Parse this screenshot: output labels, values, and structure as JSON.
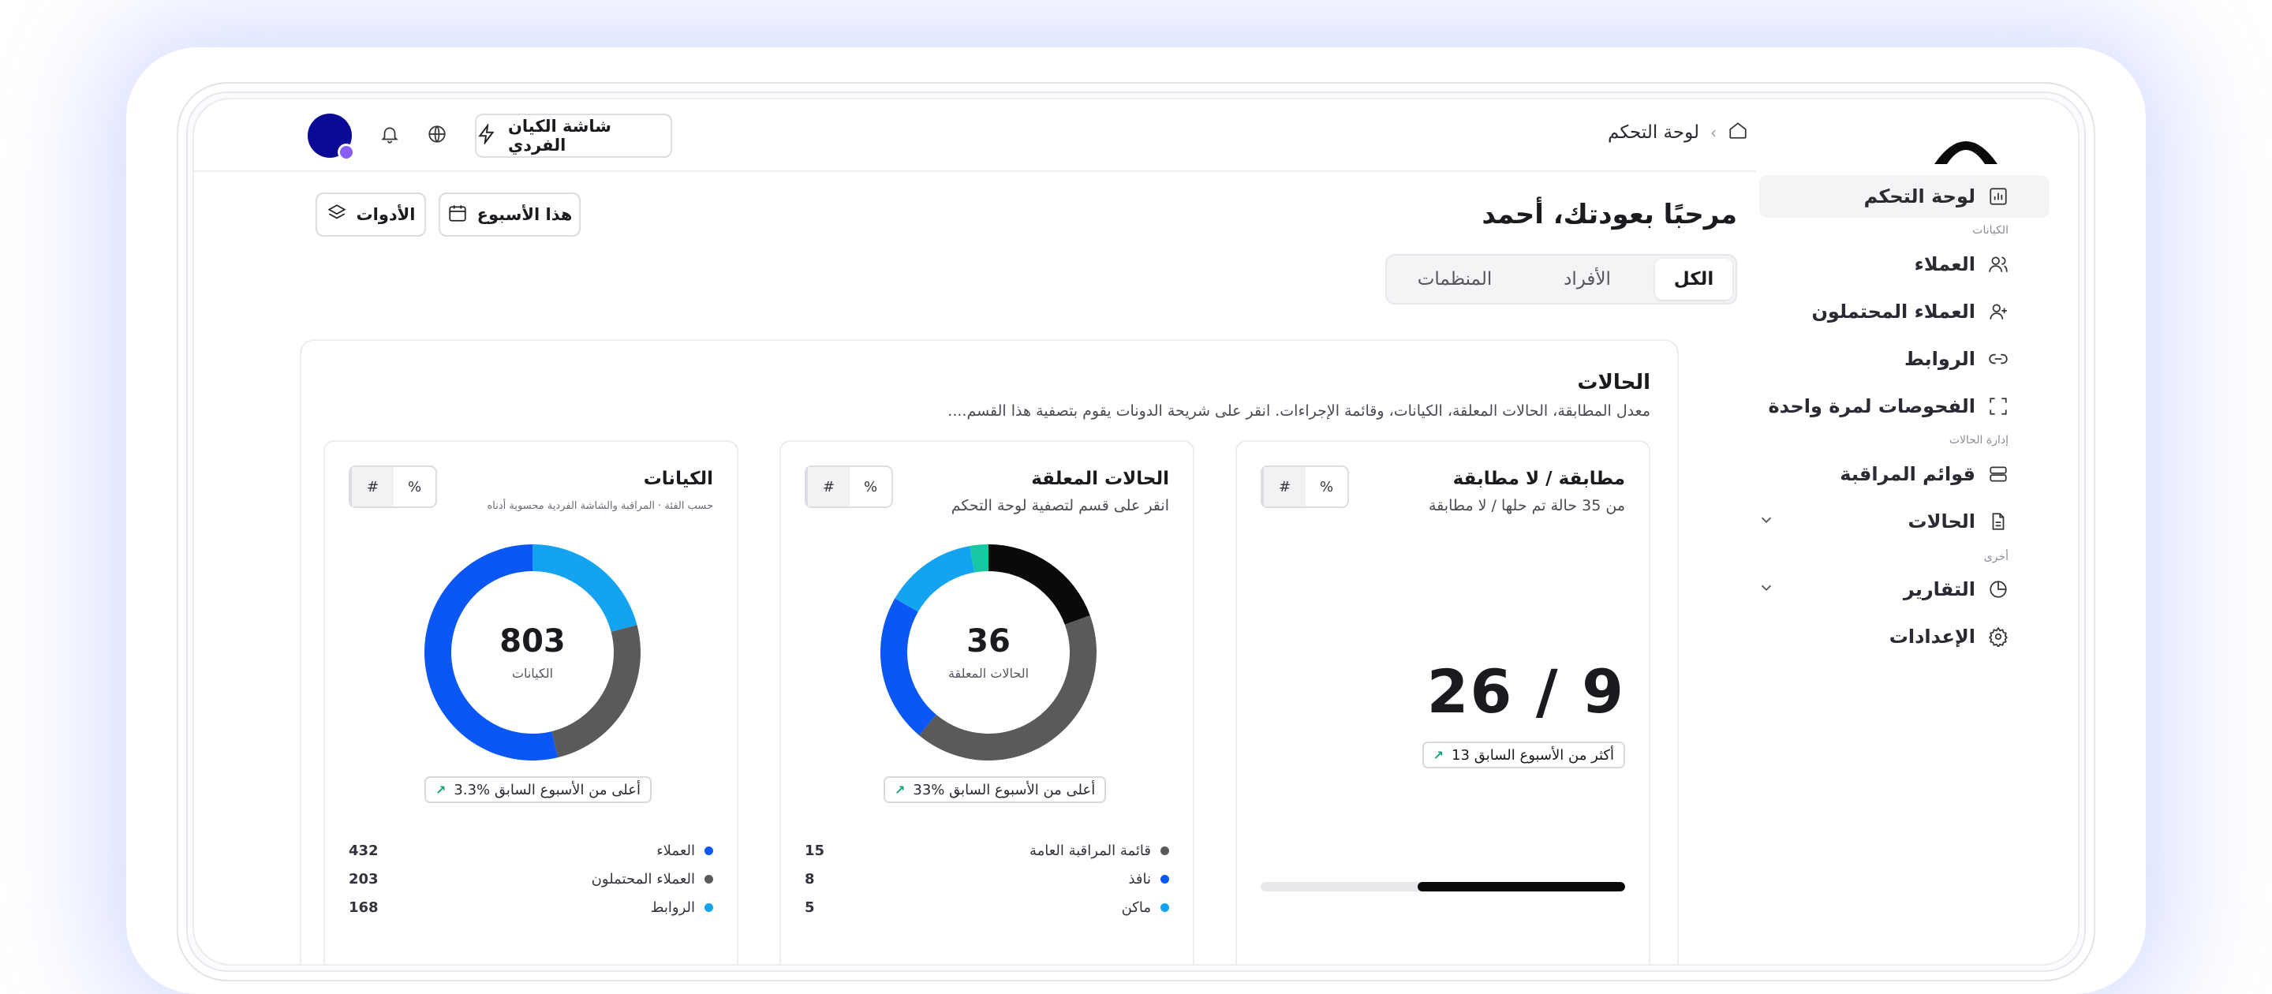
{
  "colors": {
    "primary_blue": "#0b57f5",
    "sky_blue": "#14a3f0",
    "dark_gray": "#5a5a5a",
    "black": "#0a0a0a",
    "teal": "#16c9a4",
    "avatar": "#0a0a96",
    "avatar_badge": "#8a5cf6",
    "positive": "#12a37a"
  },
  "sidebar": {
    "items": [
      {
        "label": "لوحة التحكم",
        "icon": "chart-icon"
      },
      {
        "label": "العملاء",
        "icon": "users-icon"
      },
      {
        "label": "العملاء المحتملون",
        "icon": "user-plus-icon"
      },
      {
        "label": "الروابط",
        "icon": "link-icon"
      },
      {
        "label": "الفحوصات لمرة واحدة",
        "icon": "scan-icon"
      },
      {
        "label": "قوائم المراقبة",
        "icon": "server-icon"
      },
      {
        "label": "الحالات",
        "icon": "file-icon"
      },
      {
        "label": "التقارير",
        "icon": "pie-icon"
      },
      {
        "label": "الإعدادات",
        "icon": "gear-icon"
      }
    ],
    "sections": {
      "entities": "الكيانات",
      "cases_mgmt": "إدارة الحالات",
      "other": "أخرى"
    }
  },
  "topbar": {
    "breadcrumb": "لوحة التحكم",
    "switch_label": "شاشة الكيان الفردي"
  },
  "header": {
    "title": "مرحبًا بعودتك، أحمد",
    "week_label": "هذا الأسبوع",
    "tools_label": "الأدوات"
  },
  "tabs": [
    "الكل",
    "الأفراد",
    "المنظمات"
  ],
  "panel": {
    "title": "الحالات",
    "subtitle": "معدل المطابقة، الحالات المعلقة، الكيانات، وقائمة الإجراءات. انقر على شريحة الدونات يقوم بتصفية هذا القسم...."
  },
  "toggle": {
    "percent": "%",
    "hash": "#"
  },
  "match_card": {
    "title": "مطابقة / لا مطابقة",
    "subtitle": "من 35 حالة تم حلها / لا مطابقة",
    "stat": "26 / 9",
    "delta": "13 أكثر من الأسبوع السابق",
    "progress_fraction": 0.57
  },
  "pending_card": {
    "title": "الحالات المعلقة",
    "subtitle": "انقر على قسم لتصفية لوحة التحكم",
    "total": "36",
    "total_label": "الحالات المعلقة",
    "delta": "33% أعلى من الأسبوع السابق",
    "legend": [
      {
        "label": "قائمة المراقبة العامة",
        "value": "15",
        "color": "#5a5a5a"
      },
      {
        "label": "نافذ",
        "value": "8",
        "color": "#0b57f5"
      },
      {
        "label": "ماكن",
        "value": "5",
        "color": "#14a3f0"
      }
    ],
    "chart_data": {
      "type": "pie",
      "values": [
        7,
        15,
        8,
        5,
        1
      ],
      "colors": [
        "#0a0a0a",
        "#5a5a5a",
        "#0b57f5",
        "#14a3f0",
        "#16c9a4"
      ]
    }
  },
  "entities_card": {
    "title": "الكيانات",
    "subtitle": "حسب الفئة · المراقبة والشاشة الفردية محسوبة أدناه",
    "total": "803",
    "total_label": "الكيانات",
    "delta": "3.3% أعلى من الأسبوع السابق",
    "legend": [
      {
        "label": "العملاء",
        "value": "432",
        "color": "#0b57f5"
      },
      {
        "label": "العملاء المحتملون",
        "value": "203",
        "color": "#5a5a5a"
      },
      {
        "label": "الروابط",
        "value": "168",
        "color": "#14a3f0"
      }
    ],
    "chart_data": {
      "type": "pie",
      "values": [
        168,
        203,
        432
      ],
      "colors": [
        "#14a3f0",
        "#5a5a5a",
        "#0b57f5"
      ]
    }
  }
}
